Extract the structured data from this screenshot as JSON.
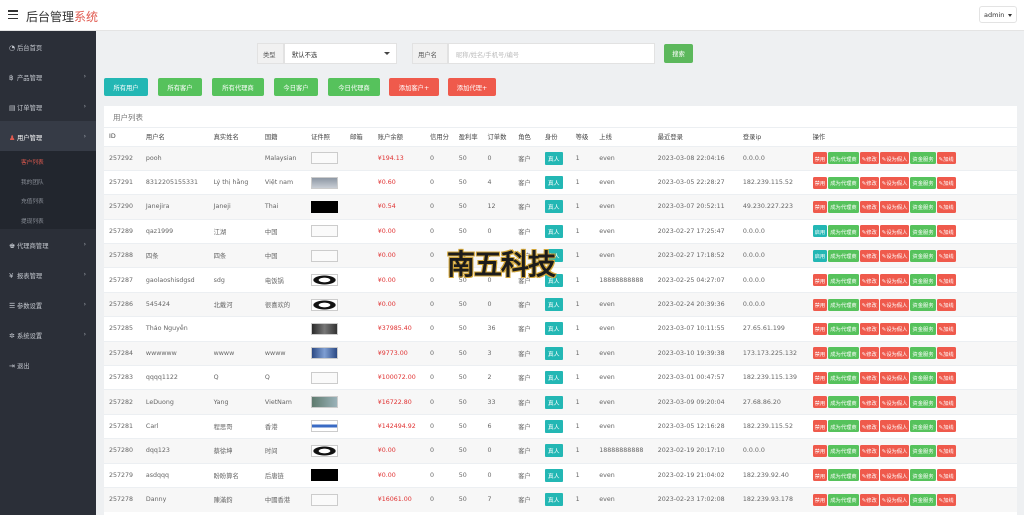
{
  "header": {
    "title_main": "后台管理",
    "title_accent": "系统",
    "user": "admin"
  },
  "sidebar": {
    "items": [
      {
        "label": "后台首页",
        "icon": "dashboard-icon"
      },
      {
        "label": "产品管理",
        "icon": "bitcoin-icon"
      },
      {
        "label": "订单管理",
        "icon": "clipboard-icon"
      },
      {
        "label": "用户管理",
        "icon": "users-icon",
        "active": true
      },
      {
        "label": "代理商管理",
        "icon": "user-group-icon"
      },
      {
        "label": "报表管理",
        "icon": "yen-icon"
      },
      {
        "label": "参数设置",
        "icon": "sliders-icon"
      },
      {
        "label": "系统设置",
        "icon": "cogs-icon"
      },
      {
        "label": "退出",
        "icon": "logout-icon"
      }
    ],
    "subitems": [
      "客户列表",
      "我的团队",
      "充值列表",
      "提现列表"
    ]
  },
  "search": {
    "type_label": "类型",
    "type_value": "默认不选",
    "user_label": "用户名",
    "user_placeholder": "昵称/姓名/手机号/编号",
    "button": "搜索"
  },
  "filters": [
    "所有用户",
    "所有客户",
    "所有代理商",
    "今日客户",
    "今日代理商",
    "添加客户+",
    "添加代理+"
  ],
  "list_title": "用户列表",
  "columns": [
    "ID",
    "用户名",
    "真实姓名",
    "国籍",
    "证件照",
    "邮箱",
    "账户余额",
    "信用分",
    "盈利率",
    "订单数",
    "角色",
    "身份",
    "等级",
    "上线",
    "最近登录",
    "登录ip",
    "操作"
  ],
  "actions": {
    "disable": "禁用",
    "enable": "启用",
    "make_agent": "成为代理商",
    "edit": "✎修改",
    "set_fake": "✎设为假人",
    "funds": "资金服务",
    "add_line": "✎加线"
  },
  "rows": [
    {
      "id": "257292",
      "username": "pooh",
      "realname": "",
      "country": "Malaysian",
      "balance": "¥194.13",
      "credit": "0",
      "profit": "50",
      "orders": "0",
      "role": "客户",
      "identity": "真人",
      "level": "1",
      "upline": "even",
      "last_login": "2023-03-08 22:04:16",
      "ip": "0.0.0.0",
      "status": "disable"
    },
    {
      "id": "257291",
      "username": "8312205155331",
      "realname": "Lý thị hằng",
      "country": "Việt nam",
      "balance": "¥0.60",
      "credit": "0",
      "profit": "50",
      "orders": "4",
      "role": "客户",
      "identity": "真人",
      "level": "1",
      "upline": "even",
      "last_login": "2023-03-05 22:28:27",
      "ip": "182.239.115.52",
      "status": "disable"
    },
    {
      "id": "257290",
      "username": "Janejira",
      "realname": "Janeji",
      "country": "Thai",
      "balance": "¥0.54",
      "credit": "0",
      "profit": "50",
      "orders": "12",
      "role": "客户",
      "identity": "真人",
      "level": "1",
      "upline": "even",
      "last_login": "2023-03-07 20:52:11",
      "ip": "49.230.227.223",
      "status": "disable"
    },
    {
      "id": "257289",
      "username": "qaz1999",
      "realname": "江湖",
      "country": "中国",
      "balance": "¥0.00",
      "credit": "0",
      "profit": "50",
      "orders": "0",
      "role": "客户",
      "identity": "真人",
      "level": "1",
      "upline": "even",
      "last_login": "2023-02-27 17:25:47",
      "ip": "0.0.0.0",
      "status": "enable"
    },
    {
      "id": "257288",
      "username": "四条",
      "realname": "四条",
      "country": "中国",
      "balance": "¥0.00",
      "credit": "0",
      "profit": "50",
      "orders": "0",
      "role": "客户",
      "identity": "真人",
      "level": "1",
      "upline": "even",
      "last_login": "2023-02-27 17:18:52",
      "ip": "0.0.0.0",
      "status": "enable"
    },
    {
      "id": "257287",
      "username": "gaolaoshisdgsd",
      "realname": "sdg",
      "country": "电饭锅",
      "balance": "¥0.00",
      "credit": "0",
      "profit": "50",
      "orders": "0",
      "role": "客户",
      "identity": "真人",
      "level": "1",
      "upline": "18888888888",
      "last_login": "2023-02-25 04:27:07",
      "ip": "0.0.0.0",
      "status": "disable"
    },
    {
      "id": "257286",
      "username": "545424",
      "realname": "北戴河",
      "country": "很喜欢的",
      "balance": "¥0.00",
      "credit": "0",
      "profit": "50",
      "orders": "0",
      "role": "客户",
      "identity": "真人",
      "level": "1",
      "upline": "even",
      "last_login": "2023-02-24 20:39:36",
      "ip": "0.0.0.0",
      "status": "disable"
    },
    {
      "id": "257285",
      "username": "Thảo Nguyễn",
      "realname": "",
      "country": "",
      "balance": "¥37985.40",
      "credit": "0",
      "profit": "50",
      "orders": "36",
      "role": "客户",
      "identity": "真人",
      "level": "1",
      "upline": "even",
      "last_login": "2023-03-07 10:11:55",
      "ip": "27.65.61.199",
      "status": "disable"
    },
    {
      "id": "257284",
      "username": "wwwwww",
      "realname": "wwww",
      "country": "wwww",
      "balance": "¥9773.00",
      "credit": "0",
      "profit": "50",
      "orders": "3",
      "role": "客户",
      "identity": "真人",
      "level": "1",
      "upline": "even",
      "last_login": "2023-03-10 19:39:38",
      "ip": "173.173.225.132",
      "status": "disable"
    },
    {
      "id": "257283",
      "username": "qqqq1122",
      "realname": "Q",
      "country": "Q",
      "balance": "¥100072.00",
      "credit": "0",
      "profit": "50",
      "orders": "2",
      "role": "客户",
      "identity": "真人",
      "level": "1",
      "upline": "even",
      "last_login": "2023-03-01 00:47:57",
      "ip": "182.239.115.139",
      "status": "disable"
    },
    {
      "id": "257282",
      "username": "LeDuong",
      "realname": "Yang",
      "country": "VietNam",
      "balance": "¥16722.80",
      "credit": "0",
      "profit": "50",
      "orders": "33",
      "role": "客户",
      "identity": "真人",
      "level": "1",
      "upline": "even",
      "last_login": "2023-03-09 09:20:04",
      "ip": "27.68.86.20",
      "status": "disable"
    },
    {
      "id": "257281",
      "username": "Carl",
      "realname": "程思哥",
      "country": "香港",
      "balance": "¥142494.92",
      "credit": "0",
      "profit": "50",
      "orders": "6",
      "role": "客户",
      "identity": "真人",
      "level": "1",
      "upline": "even",
      "last_login": "2023-03-05 12:16:28",
      "ip": "182.239.115.52",
      "status": "disable"
    },
    {
      "id": "257280",
      "username": "dqq123",
      "realname": "蔡徐坤",
      "country": "时间",
      "balance": "¥0.00",
      "credit": "0",
      "profit": "50",
      "orders": "0",
      "role": "客户",
      "identity": "真人",
      "level": "1",
      "upline": "18888888888",
      "last_login": "2023-02-19 20:17:10",
      "ip": "0.0.0.0",
      "status": "disable"
    },
    {
      "id": "257279",
      "username": "asdqqq",
      "realname": "盼盼算名",
      "country": "后唐链",
      "balance": "¥0.00",
      "credit": "0",
      "profit": "50",
      "orders": "0",
      "role": "客户",
      "identity": "真人",
      "level": "1",
      "upline": "even",
      "last_login": "2023-02-19 21:04:02",
      "ip": "182.239.92.40",
      "status": "disable"
    },
    {
      "id": "257278",
      "username": "Danny",
      "realname": "陳滿鈞",
      "country": "中國香港",
      "balance": "¥16061.00",
      "credit": "0",
      "profit": "50",
      "orders": "7",
      "role": "客户",
      "identity": "真人",
      "level": "1",
      "upline": "even",
      "last_login": "2023-02-23 17:02:08",
      "ip": "182.239.93.178",
      "status": "disable"
    }
  ],
  "colors": {
    "accent": "#e05a4f",
    "sidebar_bg": "#2b2f38",
    "green": "#56c25c",
    "teal": "#23b7b4",
    "red": "#ef5a4c",
    "balance": "#e03030"
  },
  "watermark": "南五科技"
}
